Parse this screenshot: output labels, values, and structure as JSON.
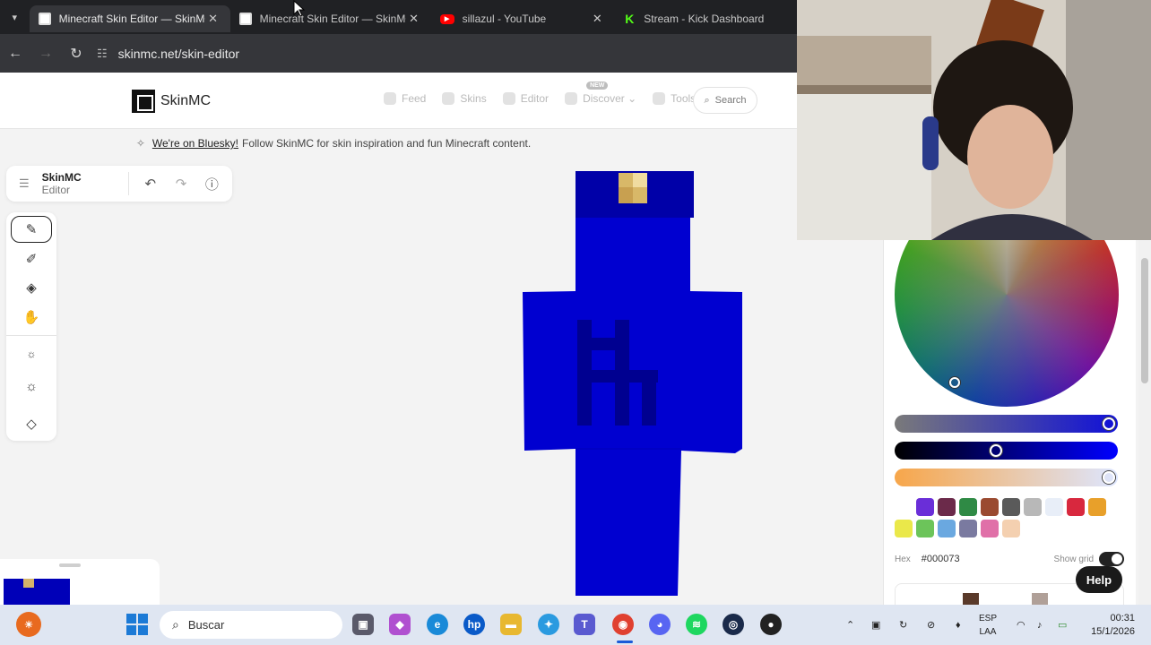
{
  "browser": {
    "tabs": [
      {
        "title": "Minecraft Skin Editor — SkinMC",
        "icon": "skinmc-favicon",
        "active": true
      },
      {
        "title": "Minecraft Skin Editor — SkinMC",
        "icon": "skinmc-favicon",
        "active": false
      },
      {
        "title": "sillazul - YouTube",
        "icon": "youtube-favicon",
        "active": false
      },
      {
        "title": "Stream - Kick Dashboard",
        "icon": "kick-favicon",
        "active": false
      }
    ],
    "url": "skinmc.net/skin-editor"
  },
  "site": {
    "logo": "SkinMC",
    "nav": [
      {
        "label": "Feed",
        "icon": "feed-icon"
      },
      {
        "label": "Skins",
        "icon": "skins-icon"
      },
      {
        "label": "Editor",
        "icon": "editor-icon"
      },
      {
        "label": "Discover",
        "icon": "discover-icon",
        "badge": "NEW"
      },
      {
        "label": "Tools",
        "icon": "tools-icon"
      }
    ],
    "search_label": "Search",
    "announcement": {
      "link": "We're on Bluesky!",
      "text": "Follow SkinMC for skin inspiration and fun Minecraft content."
    }
  },
  "editor": {
    "title_bold": "SkinMC",
    "title_rest": "Editor",
    "tools": [
      "pen-icon",
      "eyedropper-icon",
      "bucket-icon",
      "hand-icon",
      "darken-icon",
      "lighten-icon",
      "eraser-icon"
    ],
    "selected_tool": "pen-icon"
  },
  "color_panel": {
    "hex_label": "Hex",
    "hex_value": "#000073",
    "grid_label": "Show grid",
    "swatches": [
      "#ffffff",
      "#6a2ed8",
      "#6b2a4a",
      "#2f8a45",
      "#9a4a30",
      "#5a5a5a",
      "#b8b8b8",
      "#e8eef8",
      "#d8283e",
      "#e8a02a",
      "#eae84a",
      "#6cc45a",
      "#6aa8e0",
      "#7a7aa0",
      "#e070a8",
      "#f4d0b0"
    ],
    "slider_levels": [
      0.96,
      0.45,
      0.96
    ]
  },
  "help_label": "Help",
  "taskbar": {
    "search_placeholder": "Buscar",
    "lang_1": "ESP",
    "lang_2": "LAA",
    "time": "00:31",
    "date": "15/1/2026"
  },
  "colors": {
    "skin_body": "#0000d0",
    "skin_dark": "#000090",
    "skin_collar": "#0000a8",
    "skin_gold": "#d8b868"
  }
}
